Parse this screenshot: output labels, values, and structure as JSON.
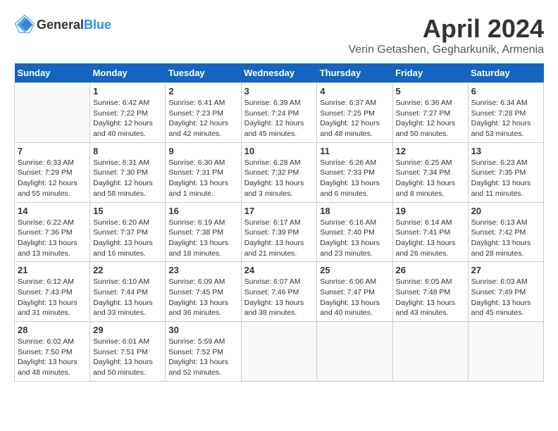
{
  "header": {
    "logo_general": "General",
    "logo_blue": "Blue",
    "month_year": "April 2024",
    "location": "Verin Getashen, Gegharkunik, Armenia"
  },
  "weekdays": [
    "Sunday",
    "Monday",
    "Tuesday",
    "Wednesday",
    "Thursday",
    "Friday",
    "Saturday"
  ],
  "weeks": [
    [
      {
        "day": "",
        "sunrise": "",
        "sunset": "",
        "daylight": ""
      },
      {
        "day": "1",
        "sunrise": "Sunrise: 6:42 AM",
        "sunset": "Sunset: 7:22 PM",
        "daylight": "Daylight: 12 hours and 40 minutes."
      },
      {
        "day": "2",
        "sunrise": "Sunrise: 6:41 AM",
        "sunset": "Sunset: 7:23 PM",
        "daylight": "Daylight: 12 hours and 42 minutes."
      },
      {
        "day": "3",
        "sunrise": "Sunrise: 6:39 AM",
        "sunset": "Sunset: 7:24 PM",
        "daylight": "Daylight: 12 hours and 45 minutes."
      },
      {
        "day": "4",
        "sunrise": "Sunrise: 6:37 AM",
        "sunset": "Sunset: 7:25 PM",
        "daylight": "Daylight: 12 hours and 48 minutes."
      },
      {
        "day": "5",
        "sunrise": "Sunrise: 6:36 AM",
        "sunset": "Sunset: 7:27 PM",
        "daylight": "Daylight: 12 hours and 50 minutes."
      },
      {
        "day": "6",
        "sunrise": "Sunrise: 6:34 AM",
        "sunset": "Sunset: 7:28 PM",
        "daylight": "Daylight: 12 hours and 53 minutes."
      }
    ],
    [
      {
        "day": "7",
        "sunrise": "Sunrise: 6:33 AM",
        "sunset": "Sunset: 7:29 PM",
        "daylight": "Daylight: 12 hours and 55 minutes."
      },
      {
        "day": "8",
        "sunrise": "Sunrise: 6:31 AM",
        "sunset": "Sunset: 7:30 PM",
        "daylight": "Daylight: 12 hours and 58 minutes."
      },
      {
        "day": "9",
        "sunrise": "Sunrise: 6:30 AM",
        "sunset": "Sunset: 7:31 PM",
        "daylight": "Daylight: 13 hours and 1 minute."
      },
      {
        "day": "10",
        "sunrise": "Sunrise: 6:28 AM",
        "sunset": "Sunset: 7:32 PM",
        "daylight": "Daylight: 13 hours and 3 minutes."
      },
      {
        "day": "11",
        "sunrise": "Sunrise: 6:26 AM",
        "sunset": "Sunset: 7:33 PM",
        "daylight": "Daylight: 13 hours and 6 minutes."
      },
      {
        "day": "12",
        "sunrise": "Sunrise: 6:25 AM",
        "sunset": "Sunset: 7:34 PM",
        "daylight": "Daylight: 13 hours and 8 minutes."
      },
      {
        "day": "13",
        "sunrise": "Sunrise: 6:23 AM",
        "sunset": "Sunset: 7:35 PM",
        "daylight": "Daylight: 13 hours and 11 minutes."
      }
    ],
    [
      {
        "day": "14",
        "sunrise": "Sunrise: 6:22 AM",
        "sunset": "Sunset: 7:36 PM",
        "daylight": "Daylight: 13 hours and 13 minutes."
      },
      {
        "day": "15",
        "sunrise": "Sunrise: 6:20 AM",
        "sunset": "Sunset: 7:37 PM",
        "daylight": "Daylight: 13 hours and 16 minutes."
      },
      {
        "day": "16",
        "sunrise": "Sunrise: 6:19 AM",
        "sunset": "Sunset: 7:38 PM",
        "daylight": "Daylight: 13 hours and 18 minutes."
      },
      {
        "day": "17",
        "sunrise": "Sunrise: 6:17 AM",
        "sunset": "Sunset: 7:39 PM",
        "daylight": "Daylight: 13 hours and 21 minutes."
      },
      {
        "day": "18",
        "sunrise": "Sunrise: 6:16 AM",
        "sunset": "Sunset: 7:40 PM",
        "daylight": "Daylight: 13 hours and 23 minutes."
      },
      {
        "day": "19",
        "sunrise": "Sunrise: 6:14 AM",
        "sunset": "Sunset: 7:41 PM",
        "daylight": "Daylight: 13 hours and 26 minutes."
      },
      {
        "day": "20",
        "sunrise": "Sunrise: 6:13 AM",
        "sunset": "Sunset: 7:42 PM",
        "daylight": "Daylight: 13 hours and 28 minutes."
      }
    ],
    [
      {
        "day": "21",
        "sunrise": "Sunrise: 6:12 AM",
        "sunset": "Sunset: 7:43 PM",
        "daylight": "Daylight: 13 hours and 31 minutes."
      },
      {
        "day": "22",
        "sunrise": "Sunrise: 6:10 AM",
        "sunset": "Sunset: 7:44 PM",
        "daylight": "Daylight: 13 hours and 33 minutes."
      },
      {
        "day": "23",
        "sunrise": "Sunrise: 6:09 AM",
        "sunset": "Sunset: 7:45 PM",
        "daylight": "Daylight: 13 hours and 36 minutes."
      },
      {
        "day": "24",
        "sunrise": "Sunrise: 6:07 AM",
        "sunset": "Sunset: 7:46 PM",
        "daylight": "Daylight: 13 hours and 38 minutes."
      },
      {
        "day": "25",
        "sunrise": "Sunrise: 6:06 AM",
        "sunset": "Sunset: 7:47 PM",
        "daylight": "Daylight: 13 hours and 40 minutes."
      },
      {
        "day": "26",
        "sunrise": "Sunrise: 6:05 AM",
        "sunset": "Sunset: 7:48 PM",
        "daylight": "Daylight: 13 hours and 43 minutes."
      },
      {
        "day": "27",
        "sunrise": "Sunrise: 6:03 AM",
        "sunset": "Sunset: 7:49 PM",
        "daylight": "Daylight: 13 hours and 45 minutes."
      }
    ],
    [
      {
        "day": "28",
        "sunrise": "Sunrise: 6:02 AM",
        "sunset": "Sunset: 7:50 PM",
        "daylight": "Daylight: 13 hours and 48 minutes."
      },
      {
        "day": "29",
        "sunrise": "Sunrise: 6:01 AM",
        "sunset": "Sunset: 7:51 PM",
        "daylight": "Daylight: 13 hours and 50 minutes."
      },
      {
        "day": "30",
        "sunrise": "Sunrise: 5:59 AM",
        "sunset": "Sunset: 7:52 PM",
        "daylight": "Daylight: 13 hours and 52 minutes."
      },
      {
        "day": "",
        "sunrise": "",
        "sunset": "",
        "daylight": ""
      },
      {
        "day": "",
        "sunrise": "",
        "sunset": "",
        "daylight": ""
      },
      {
        "day": "",
        "sunrise": "",
        "sunset": "",
        "daylight": ""
      },
      {
        "day": "",
        "sunrise": "",
        "sunset": "",
        "daylight": ""
      }
    ]
  ]
}
